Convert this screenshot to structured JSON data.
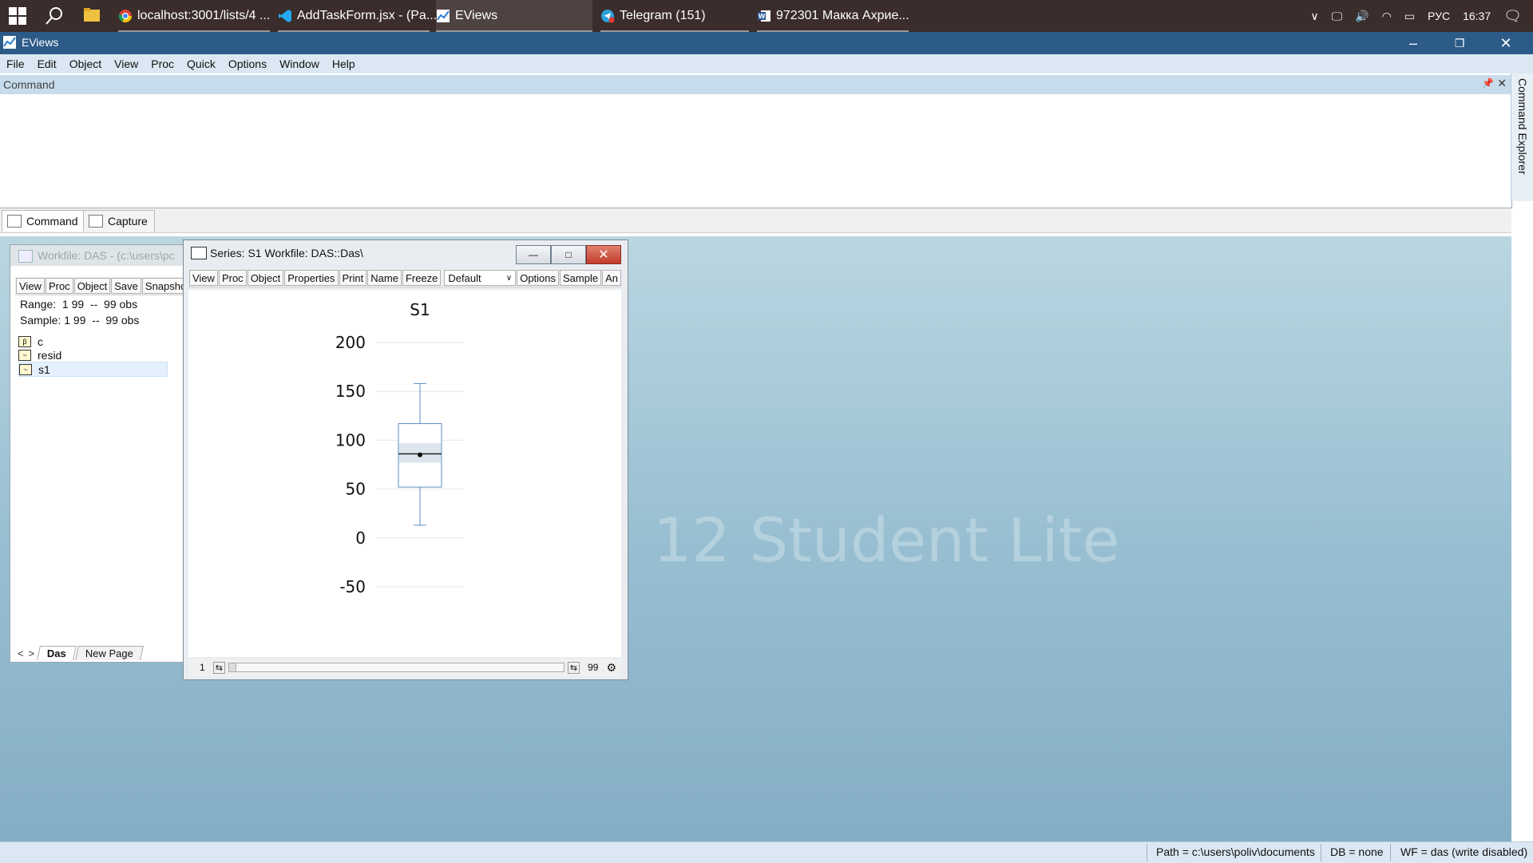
{
  "taskbar": {
    "apps": [
      {
        "label": "localhost:3001/lists/4 ...",
        "icon": "chrome-icon"
      },
      {
        "label": "AddTaskForm.jsx - (Pa...",
        "icon": "vscode-icon"
      },
      {
        "label": "EViews",
        "icon": "eviews-icon",
        "active": true
      },
      {
        "label": "Telegram (151)",
        "icon": "telegram-icon"
      },
      {
        "label": "972301 Макка Ахрие...",
        "icon": "word-icon"
      }
    ],
    "tray": {
      "language": "РУС",
      "time": "16:37"
    }
  },
  "window": {
    "title": "EViews"
  },
  "menu": [
    "File",
    "Edit",
    "Object",
    "View",
    "Proc",
    "Quick",
    "Options",
    "Window",
    "Help"
  ],
  "command_pane": {
    "header": "Command",
    "tabs": [
      "Command",
      "Capture"
    ],
    "side_tab": "Command Explorer"
  },
  "watermark": "12 Student Lite",
  "workfile_window": {
    "title": "Workfile: DAS - (c:\\users\\pc",
    "buttons": [
      "View",
      "Proc",
      "Object",
      "Save",
      "Snapsho"
    ],
    "range_line": "Range:  1 99  --  99 obs",
    "sample_line": "Sample: 1 99  --  99 obs",
    "objects": [
      {
        "name": "c",
        "type": "coef"
      },
      {
        "name": "resid",
        "type": "series"
      },
      {
        "name": "s1",
        "type": "series",
        "selected": true
      }
    ],
    "page_tabs": [
      "Das",
      "New Page"
    ]
  },
  "series_window": {
    "title": "Series: S1   Workfile: DAS::Das\\",
    "buttons": [
      "View",
      "Proc",
      "Object",
      "Properties",
      "Print",
      "Name",
      "Freeze"
    ],
    "dropdown_value": "Default",
    "buttons2": [
      "Options",
      "Sample",
      "An"
    ],
    "footer_start": "1",
    "footer_end": "99"
  },
  "chart_data": {
    "type": "boxplot",
    "title": "S1",
    "ylim": [
      -50,
      200
    ],
    "yticks": [
      200,
      150,
      100,
      50,
      0,
      -50
    ],
    "series": [
      {
        "whisker_low": 13,
        "q1": 52,
        "median": 86,
        "mean": 85,
        "q3": 117,
        "whisker_high": 158,
        "ci_low": 77,
        "ci_high": 97
      }
    ],
    "colors": {
      "box": "#5b8ec4",
      "ci_shade": "#dde6ef",
      "grid": "#e4e4e4"
    }
  },
  "statusbar": {
    "path": "Path = c:\\users\\poliv\\documents",
    "db": "DB = none",
    "wf": "WF = das (write disabled)"
  }
}
